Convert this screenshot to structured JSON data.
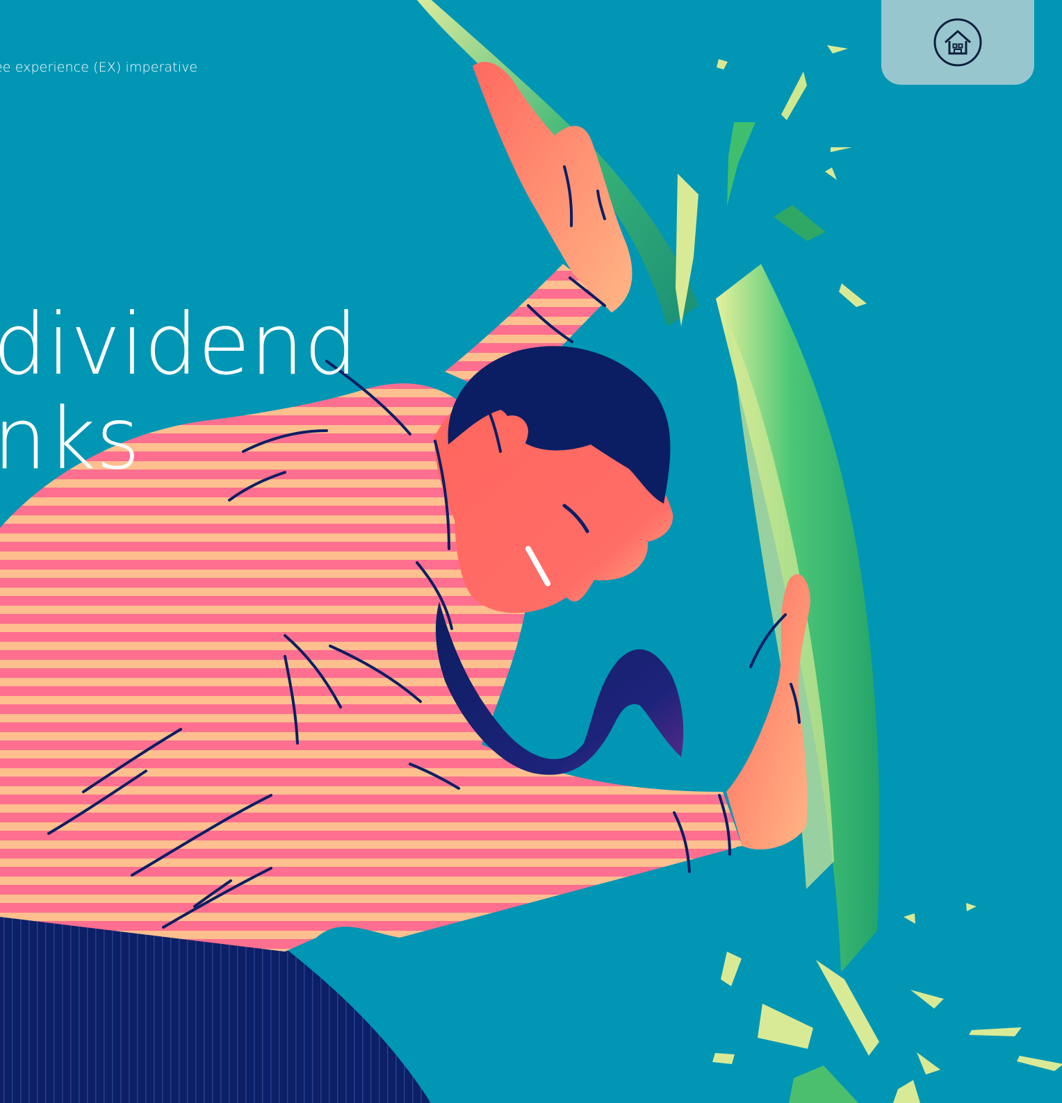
{
  "breadcrumb": {
    "text": "ee experience (EX) imperative"
  },
  "hero": {
    "line1": "dividend",
    "line2": "nks"
  },
  "home_button": {
    "label": "Home",
    "icon": "home-icon"
  },
  "illustration": {
    "description": "person pushing through shattering wall",
    "icon": "illustration"
  },
  "colors": {
    "background": "#0096b4",
    "home_tab": "#98c6cf",
    "shirt_pink": "#ff6f8f",
    "shirt_peach": "#ffbf8f",
    "skin": "#ff6b63",
    "hair_navy": "#0b1e63",
    "wall_green": "#25b66a",
    "wall_light": "#e6ef9a"
  }
}
